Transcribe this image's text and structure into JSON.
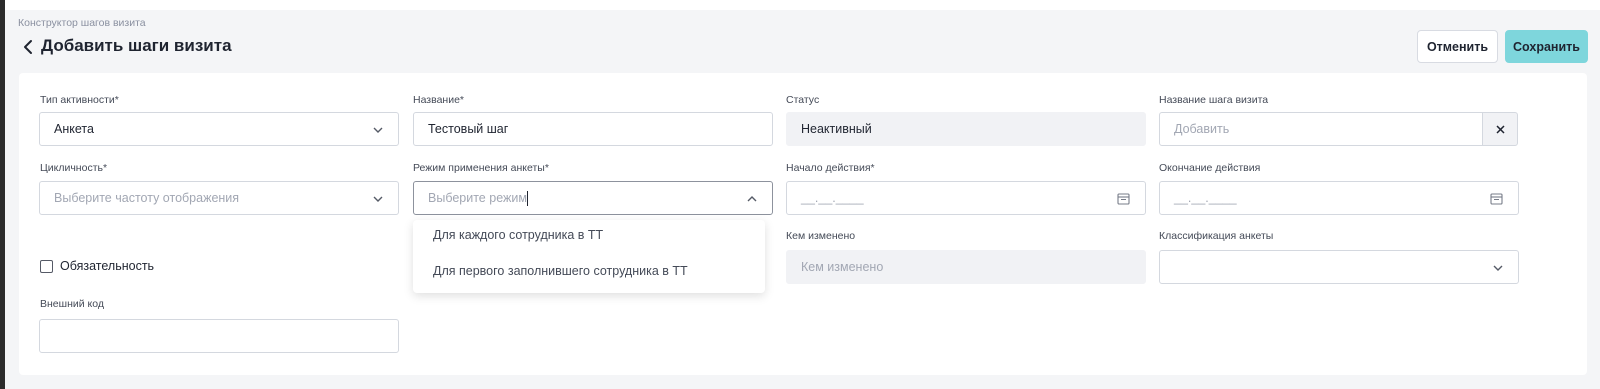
{
  "breadcrumb": "Конструктор шагов визита",
  "title": "Добавить шаги визита",
  "buttons": {
    "cancel": "Отменить",
    "save": "Сохранить"
  },
  "form": {
    "activity_type": {
      "label": "Тип активности*",
      "value": "Анкета"
    },
    "name": {
      "label": "Название*",
      "value": "Тестовый шаг"
    },
    "status": {
      "label": "Статус",
      "value": "Неактивный"
    },
    "step_name": {
      "label": "Название шага визита",
      "placeholder": "Добавить",
      "clear": "×"
    },
    "cyclicity": {
      "label": "Цикличность*",
      "placeholder": "Выберите частоту отображения"
    },
    "apply_mode": {
      "label": "Режим применения анкеты*",
      "placeholder": "Выберите режим",
      "options": [
        "Для каждого сотрудника в ТТ",
        "Для первого заполнившего сотрудника в ТТ"
      ]
    },
    "start_date": {
      "label": "Начало действия*",
      "placeholder": "__.__.____"
    },
    "end_date": {
      "label": "Окончание действия",
      "placeholder": "__.__.____"
    },
    "mandatory": {
      "label": "Обязательность",
      "checked": false
    },
    "modified_by": {
      "label": "Кем изменено",
      "placeholder": "Кем изменено"
    },
    "classification": {
      "label": "Классификация анкеты",
      "value": ""
    },
    "external_code": {
      "label": "Внешний код",
      "value": ""
    }
  },
  "icons": {
    "back": "chevron-left-icon",
    "chevron_down": "chevron-down-icon",
    "chevron_up": "chevron-up-icon",
    "calendar": "calendar-icon",
    "close": "close-icon"
  },
  "colors": {
    "accent": "#7ed6dc",
    "background": "#f4f5f7",
    "disabled_field": "#f1f2f5"
  }
}
